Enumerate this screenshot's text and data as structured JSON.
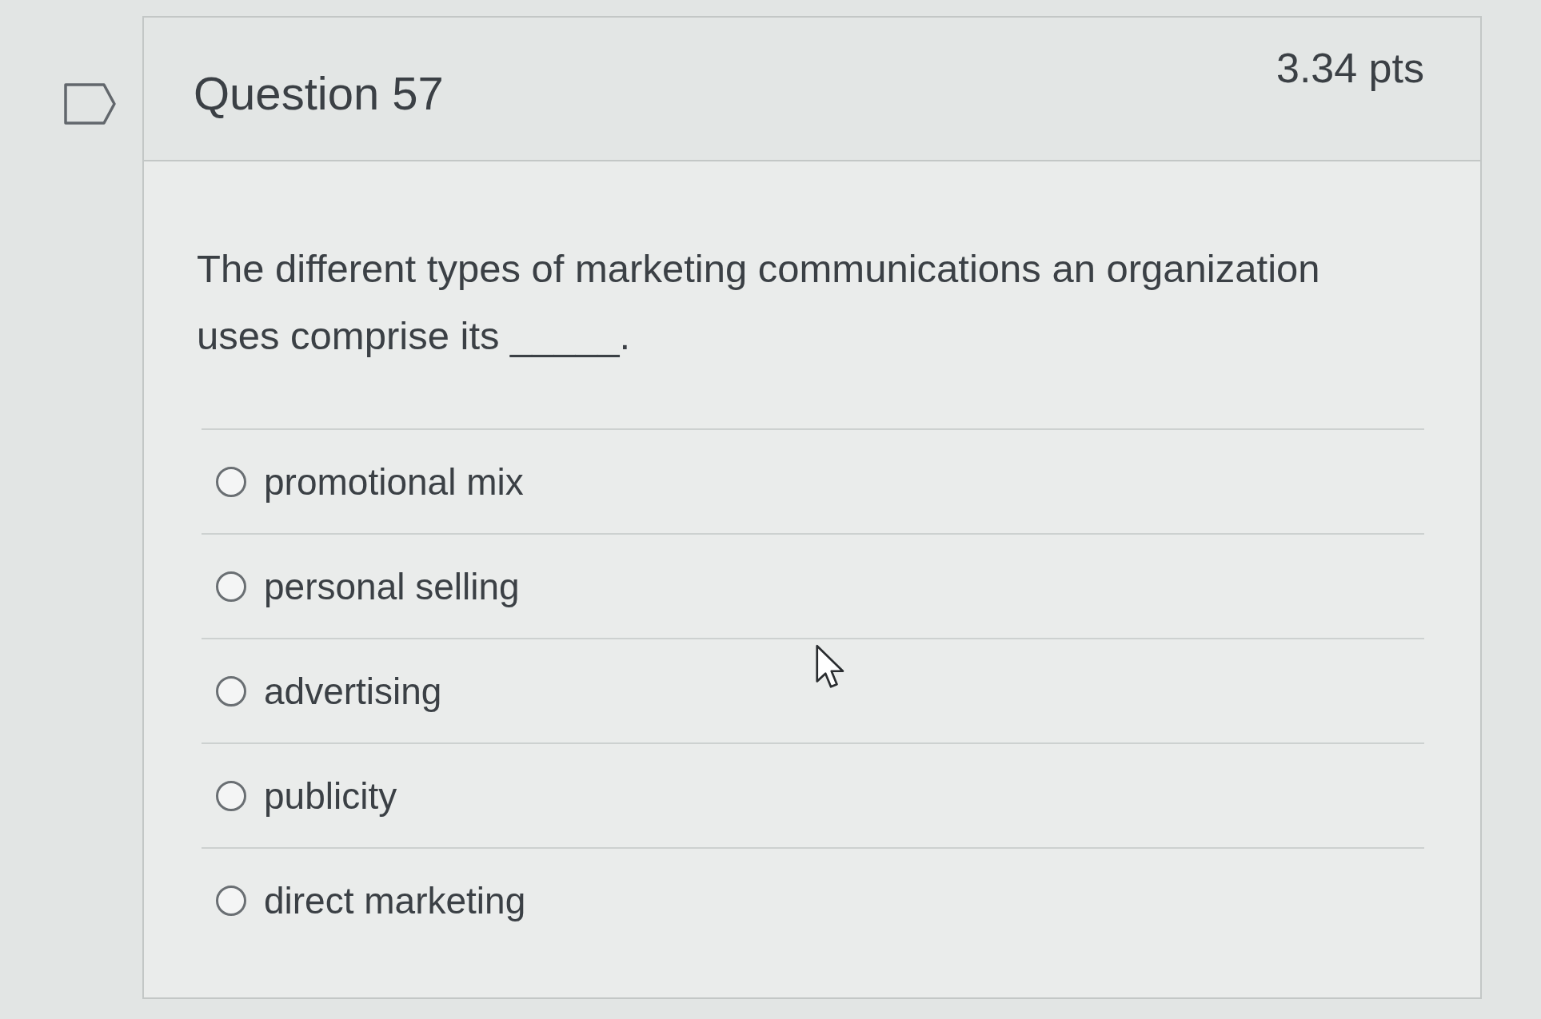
{
  "question": {
    "title": "Question 57",
    "points": "3.34 pts",
    "text": "The different types of marketing communications an organization uses comprise its _____.",
    "options": [
      {
        "label": "promotional mix",
        "selected": false
      },
      {
        "label": "personal selling",
        "selected": false
      },
      {
        "label": "advertising",
        "selected": false
      },
      {
        "label": "publicity",
        "selected": false
      },
      {
        "label": "direct marketing",
        "selected": false
      }
    ]
  }
}
